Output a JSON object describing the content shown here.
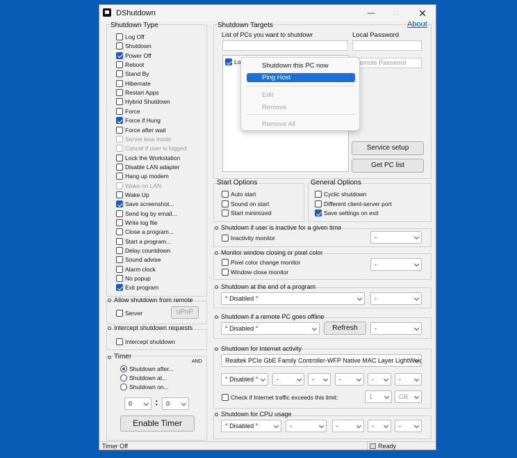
{
  "window": {
    "title": "DShutdown"
  },
  "about_link": "About",
  "shutdown_type": {
    "title": "Shutdown Type",
    "items": [
      {
        "label": "Log Off",
        "checked": false,
        "disabled": false
      },
      {
        "label": "Shutdown",
        "checked": false,
        "disabled": false
      },
      {
        "label": "Power Off",
        "checked": true,
        "disabled": false
      },
      {
        "label": "Reboot",
        "checked": false,
        "disabled": false
      },
      {
        "label": "Stand By",
        "checked": false,
        "disabled": false
      },
      {
        "label": "Hibernate",
        "checked": false,
        "disabled": false
      },
      {
        "label": "Restart Apps",
        "checked": false,
        "disabled": false
      },
      {
        "label": "Hybrid Shutdown",
        "checked": false,
        "disabled": false
      },
      {
        "label": "Force",
        "checked": false,
        "disabled": false
      },
      {
        "label": "Force if Hung",
        "checked": true,
        "disabled": false
      },
      {
        "label": "Force after wait",
        "checked": false,
        "disabled": false
      },
      {
        "label": "Server less mode",
        "checked": false,
        "disabled": true
      },
      {
        "label": "Cancel if user is logged",
        "checked": false,
        "disabled": true
      },
      {
        "label": "Lock the Workstation",
        "checked": false,
        "disabled": false
      },
      {
        "label": "Disable LAN adapter",
        "checked": false,
        "disabled": false
      },
      {
        "label": "Hang up modem",
        "checked": false,
        "disabled": false
      },
      {
        "label": "Wake on LAN",
        "checked": false,
        "disabled": true
      },
      {
        "label": "Wake Up",
        "checked": false,
        "disabled": false
      },
      {
        "label": "Save screenshot...",
        "checked": true,
        "disabled": false
      },
      {
        "label": "Send log by email...",
        "checked": false,
        "disabled": false
      },
      {
        "label": "Write log file",
        "checked": false,
        "disabled": false
      },
      {
        "label": "Close a program...",
        "checked": false,
        "disabled": false
      },
      {
        "label": "Start a program...",
        "checked": false,
        "disabled": false
      },
      {
        "label": "Delay countdown",
        "checked": false,
        "disabled": false
      },
      {
        "label": "Sound advise",
        "checked": false,
        "disabled": false
      },
      {
        "label": "Alarm clock",
        "checked": false,
        "disabled": false
      },
      {
        "label": "No popup",
        "checked": false,
        "disabled": false
      },
      {
        "label": "Exit program",
        "checked": true,
        "disabled": false
      }
    ]
  },
  "remote": {
    "title": "Allow shutdown from remote",
    "server_label": "Server",
    "upnp_label": "uPnP"
  },
  "intercept": {
    "title": "Intercept shutdown requests",
    "checkbox_label": "Intercept shutdown"
  },
  "timer": {
    "title": "Timer",
    "and_label": "AND",
    "options": [
      {
        "label": "Shutdown after...",
        "selected": true
      },
      {
        "label": "Shutdown at...",
        "selected": false
      },
      {
        "label": "Shutdown on...",
        "selected": false
      }
    ],
    "hours": "0",
    "minutes": "0",
    "separator": ":",
    "enable_button": "Enable Timer"
  },
  "targets": {
    "title": "Shutdown Targets",
    "list_label": "List of PCs you want to shutdown",
    "list_item": "Lo",
    "local_password_label": "Local Password",
    "remote_password_placeholder": "Remote Password",
    "service_setup": "Service setup",
    "get_pc_list": "Get PC list"
  },
  "context_menu": {
    "items": [
      {
        "label": "Shutdown this PC now",
        "highlighted": false,
        "disabled": false
      },
      {
        "label": "Ping Host",
        "highlighted": true,
        "disabled": false
      },
      {
        "label": "Edit",
        "highlighted": false,
        "disabled": true
      },
      {
        "label": "Remove",
        "highlighted": false,
        "disabled": true
      },
      {
        "label": "Remove All",
        "highlighted": false,
        "disabled": true
      }
    ]
  },
  "start_options": {
    "title": "Start Options",
    "items": [
      {
        "label": "Auto start",
        "checked": false
      },
      {
        "label": "Sound on start",
        "checked": false
      },
      {
        "label": "Start minimized",
        "checked": false
      }
    ]
  },
  "general_options": {
    "title": "General Options",
    "items": [
      {
        "label": "Cyclic shutdown",
        "checked": false
      },
      {
        "label": "Different client-server port",
        "checked": false
      },
      {
        "label": "Save settings on exit",
        "checked": true
      }
    ]
  },
  "inactive": {
    "title": "Shutdown if user is inactive for a given time",
    "checkbox": "Inactivity monitor",
    "select": "-"
  },
  "monitor": {
    "title": "Monitor window closing or pixel color",
    "pixel": "Pixel color change monitor",
    "window": "Window close monitor",
    "select": "-"
  },
  "end_program": {
    "title": "Shutdown at the end of a program",
    "select1": "° Disabled °",
    "select2": "-"
  },
  "remote_offline": {
    "title": "Shutdown if a remote PC goes offline",
    "select1": "° Disabled °",
    "refresh": "Refresh",
    "select2": "-"
  },
  "internet": {
    "title": "Shutdown for Internet activity",
    "adapter": "Realtek PCIe GbE Family Controller-WFP Native MAC Layer LightWeight Filter",
    "s1": "° Disabled °",
    "s2": "-",
    "s3": "-",
    "s4": "-",
    "s5": "-",
    "s6": "-",
    "traffic_label": "Check if Internet traffic exceeds this limit:",
    "limit": "1",
    "unit": "GB"
  },
  "cpu": {
    "title": "Shutdown for CPU usage",
    "s1": "° Disabled °",
    "s2": "-",
    "s3": "-",
    "s4": "-",
    "s5": "-"
  },
  "status": {
    "left": "Timer Off",
    "right": "Ready"
  }
}
